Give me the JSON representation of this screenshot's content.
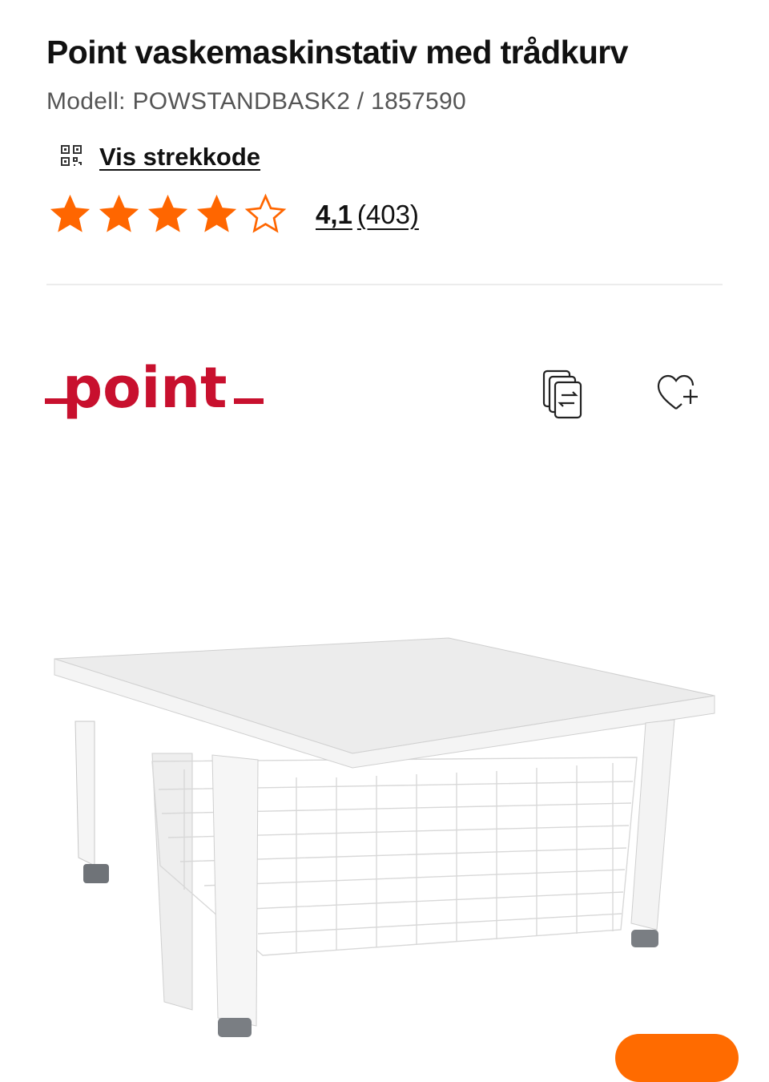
{
  "product": {
    "title": "Point vaskemaskinstativ med trådkurv",
    "model_label": "Modell: POWSTANDBASK2 / 1857590",
    "barcode_link_label": "Vis strekkode",
    "rating": {
      "score": "4,1",
      "count_label": "(403)",
      "stars_filled": 4,
      "stars_total": 5
    }
  },
  "brand": {
    "logo_text": "point",
    "logo_color": "#c8102e"
  },
  "actions": {
    "compare_icon": "compare-icon",
    "favorite_icon": "heart-plus-icon"
  },
  "colors": {
    "star": "#ff6600",
    "cta": "#ff6b00"
  }
}
